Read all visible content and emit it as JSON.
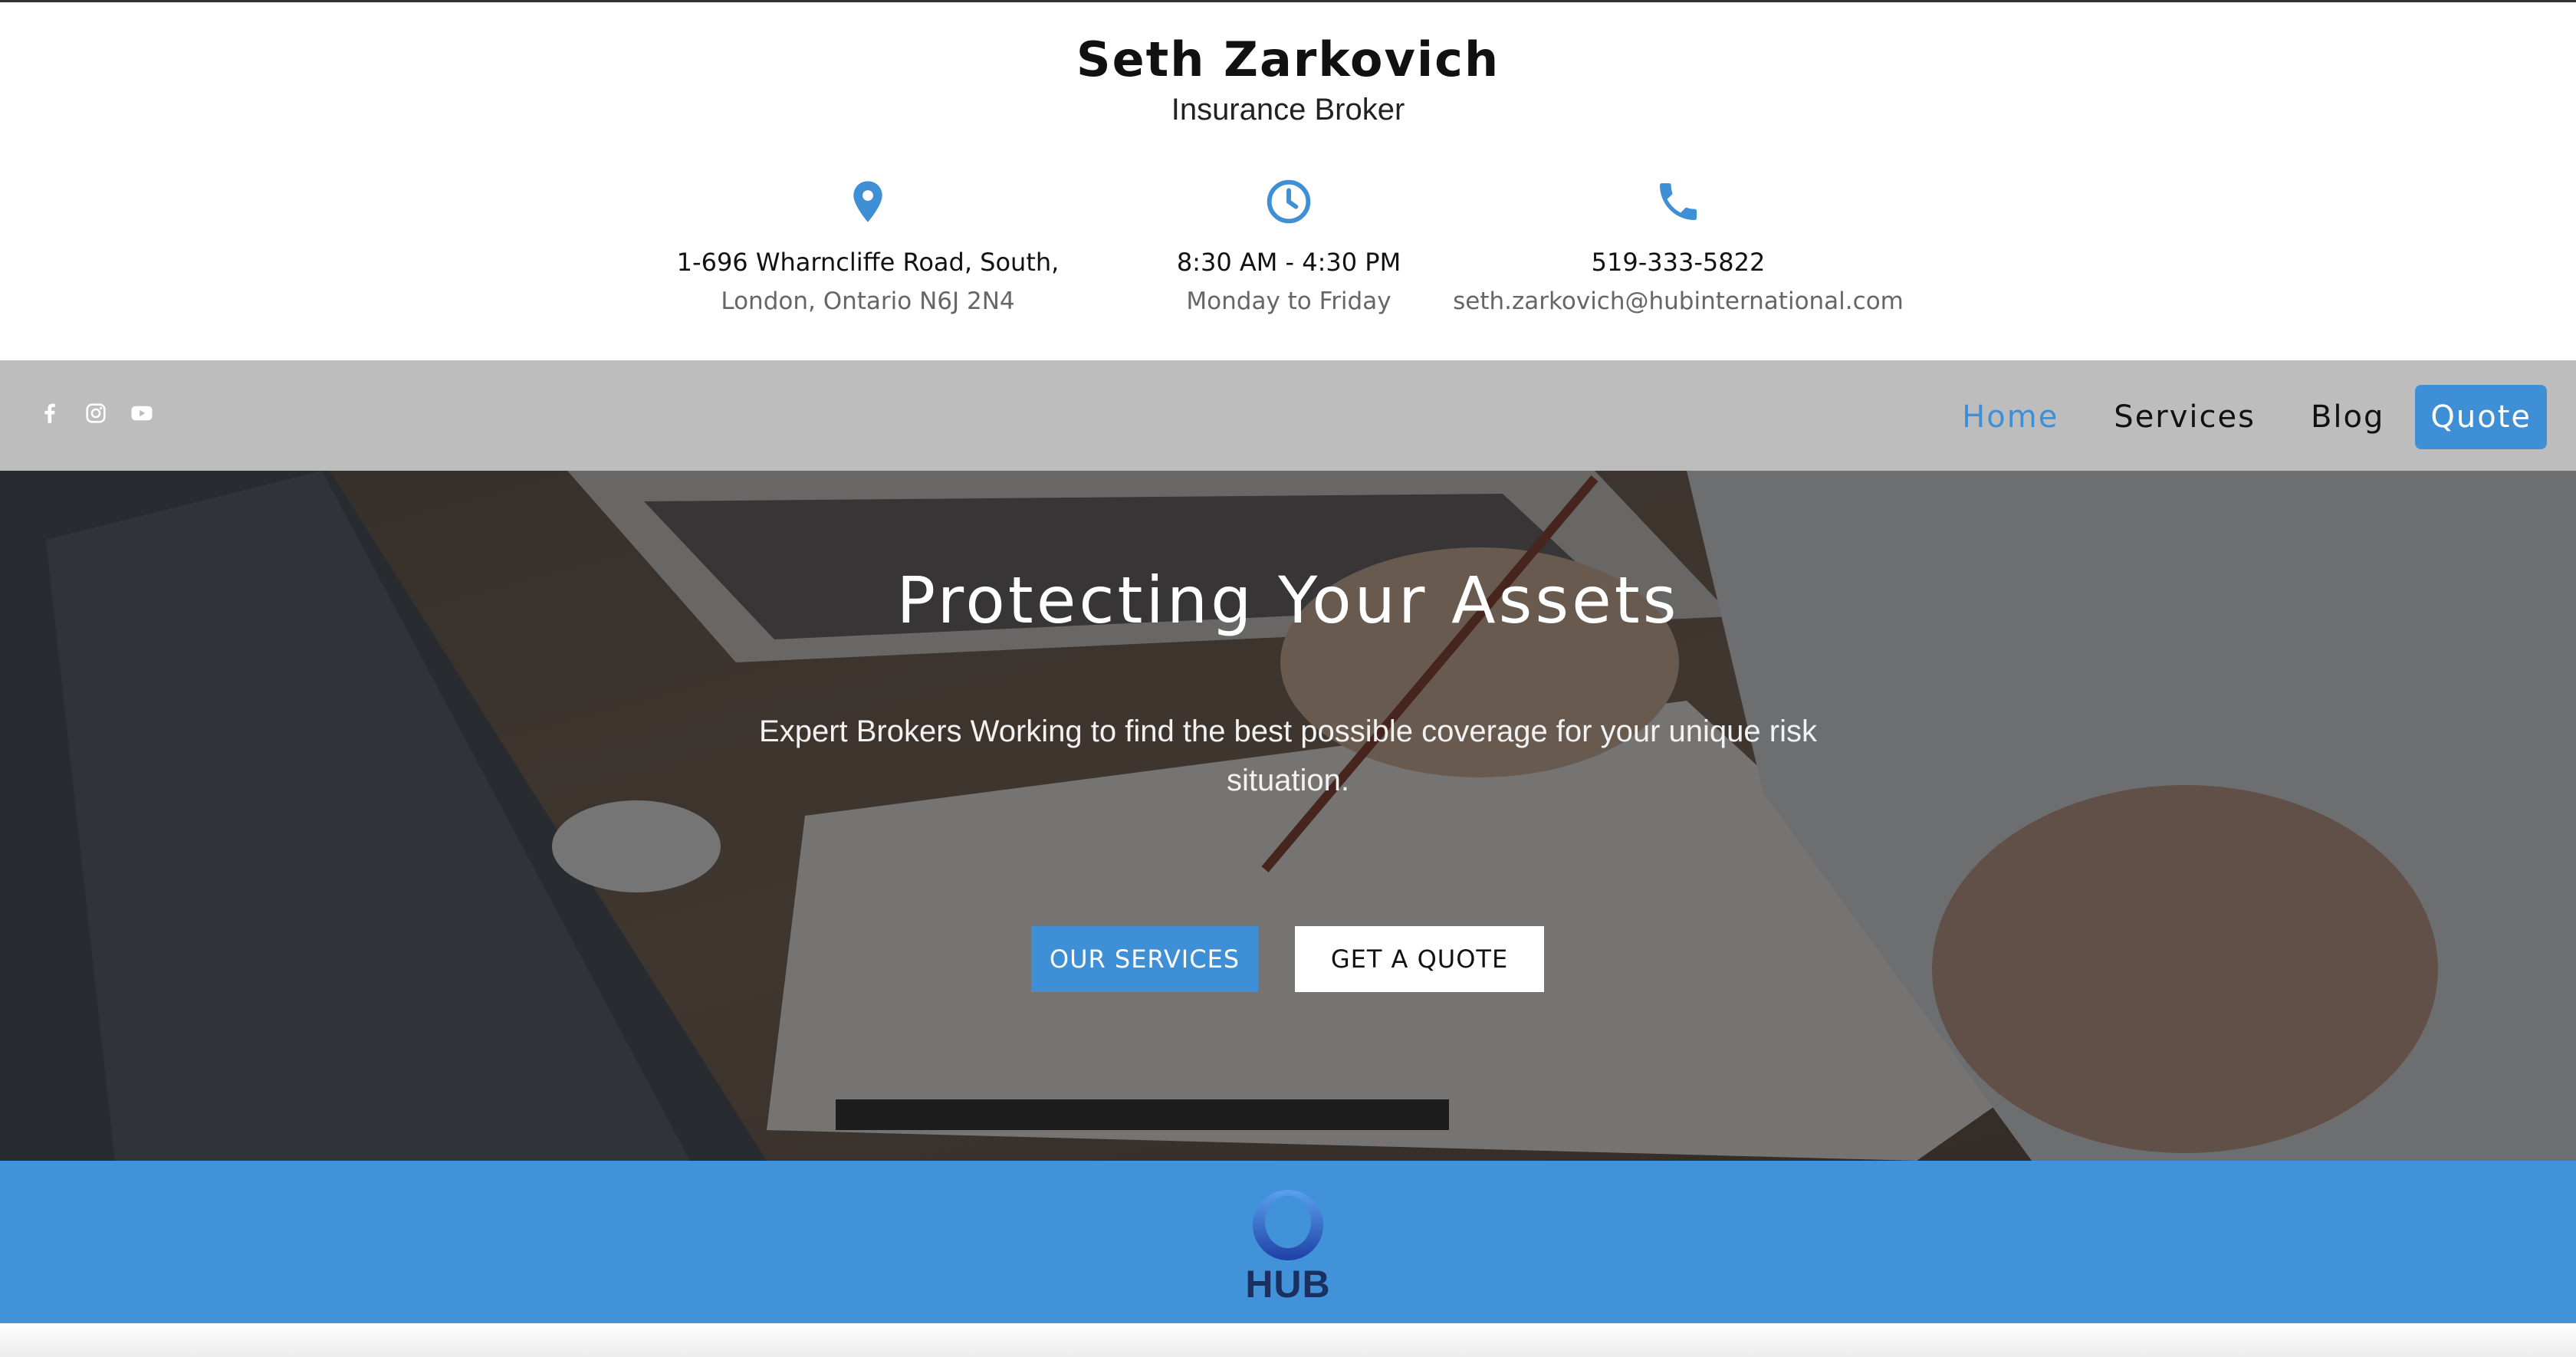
{
  "header": {
    "name": "Seth Zarkovich",
    "role": "Insurance Broker",
    "address": {
      "icon": "map-pin-icon",
      "line1": "1-696 Wharncliffe Road, South,",
      "line2": "London, Ontario N6J 2N4"
    },
    "hours": {
      "icon": "clock-icon",
      "line1": "8:30 AM - 4:30 PM",
      "line2": "Monday to Friday"
    },
    "contact": {
      "icon": "phone-icon",
      "line1": "519-333-5822",
      "line2": "seth.zarkovich@hubinternational.com"
    }
  },
  "social": [
    "facebook-icon",
    "instagram-icon",
    "youtube-icon"
  ],
  "nav": {
    "items": [
      {
        "label": "Home",
        "active": true
      },
      {
        "label": "Services",
        "active": false
      },
      {
        "label": "Blog",
        "active": false
      },
      {
        "label": "Quote",
        "active": false
      }
    ]
  },
  "hero": {
    "title": "Protecting Your Assets",
    "subtitle": "Expert Brokers Working to find the best possible coverage for your unique risk situation.",
    "primary_button": "OUR SERVICES",
    "secondary_button": "GET A QUOTE"
  },
  "logo": {
    "text": "HUB"
  },
  "colors": {
    "accent": "#3f8fd6",
    "nav_bg": "#bdbdbd",
    "band_bg": "#4192d8",
    "logo_text": "#1b2f60"
  }
}
